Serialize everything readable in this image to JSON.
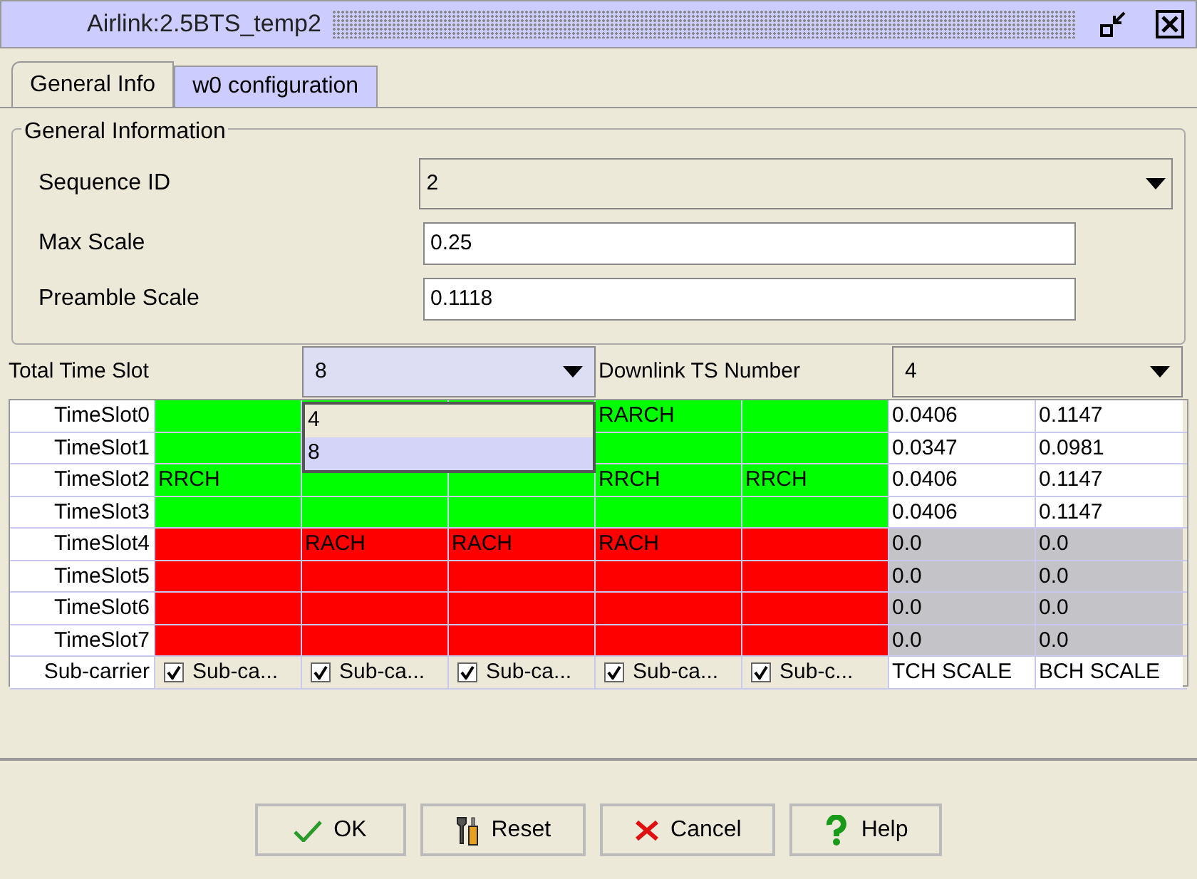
{
  "window": {
    "title": "Airlink:2.5BTS_temp2"
  },
  "tabs": [
    {
      "label": "General Info",
      "selected": true
    },
    {
      "label": "w0 configuration",
      "selected": false
    }
  ],
  "general_information": {
    "title": "General Information",
    "fields": [
      {
        "kind": "dropdown",
        "label": "Sequence ID",
        "value": "2"
      },
      {
        "kind": "text",
        "label": "Max Scale",
        "value": "0.25"
      },
      {
        "kind": "text",
        "label": "Preamble Scale",
        "value": "0.1118"
      }
    ]
  },
  "total_time_slot": {
    "label": "Total Time Slot",
    "value": "8",
    "expanded": true,
    "options": [
      {
        "label": "4",
        "selected": false
      },
      {
        "label": "8",
        "selected": true
      }
    ]
  },
  "downlink_ts_number": {
    "label": "Downlink TS Number",
    "value": "4"
  },
  "table": {
    "rows": [
      {
        "header": "TimeSlot0",
        "color": "#00ff00",
        "cells": [
          {},
          {},
          {},
          {
            "text": "RARCH"
          },
          {}
        ],
        "tch": "0.0406",
        "bch": "0.1147",
        "disabled": false
      },
      {
        "header": "TimeSlot1",
        "color": "#00ff00",
        "cells": [
          {},
          {},
          {},
          {},
          {}
        ],
        "tch": "0.0347",
        "bch": "0.0981",
        "disabled": false
      },
      {
        "header": "TimeSlot2",
        "color": "#00ff00",
        "cells": [
          {
            "text": "RRCH"
          },
          {},
          {},
          {
            "text": "RRCH"
          },
          {
            "text": "RRCH"
          }
        ],
        "tch": "0.0406",
        "bch": "0.1147",
        "disabled": false
      },
      {
        "header": "TimeSlot3",
        "color": "#00ff00",
        "cells": [
          {},
          {},
          {},
          {},
          {}
        ],
        "tch": "0.0406",
        "bch": "0.1147",
        "disabled": false
      },
      {
        "header": "TimeSlot4",
        "color": "#ff0000",
        "cells": [
          {},
          {
            "text": "RACH"
          },
          {
            "text": "RACH"
          },
          {
            "text": "RACH"
          },
          {}
        ],
        "tch": "0.0",
        "bch": "0.0",
        "disabled": true
      },
      {
        "header": "TimeSlot5",
        "color": "#ff0000",
        "cells": [
          {},
          {},
          {},
          {},
          {}
        ],
        "tch": "0.0",
        "bch": "0.0",
        "disabled": true
      },
      {
        "header": "TimeSlot6",
        "color": "#ff0000",
        "cells": [
          {},
          {},
          {},
          {},
          {}
        ],
        "tch": "0.0",
        "bch": "0.0",
        "disabled": true
      },
      {
        "header": "TimeSlot7",
        "color": "#ff0000",
        "cells": [
          {},
          {},
          {},
          {},
          {}
        ],
        "tch": "0.0",
        "bch": "0.0",
        "disabled": true
      }
    ],
    "footer": {
      "header": "Sub-carrier",
      "subcarriers": [
        {
          "label": "Sub-ca...",
          "checked": true
        },
        {
          "label": "Sub-ca...",
          "checked": true
        },
        {
          "label": "Sub-ca...",
          "checked": true
        },
        {
          "label": "Sub-ca...",
          "checked": true
        },
        {
          "label": "Sub-c...",
          "checked": true
        }
      ],
      "tch_label": "TCH SCALE",
      "bch_label": "BCH SCALE"
    }
  },
  "buttons": [
    {
      "kind": "ok",
      "label": "OK"
    },
    {
      "kind": "reset",
      "label": "Reset"
    },
    {
      "kind": "cancel",
      "label": "Cancel"
    },
    {
      "kind": "help",
      "label": "Help"
    }
  ]
}
